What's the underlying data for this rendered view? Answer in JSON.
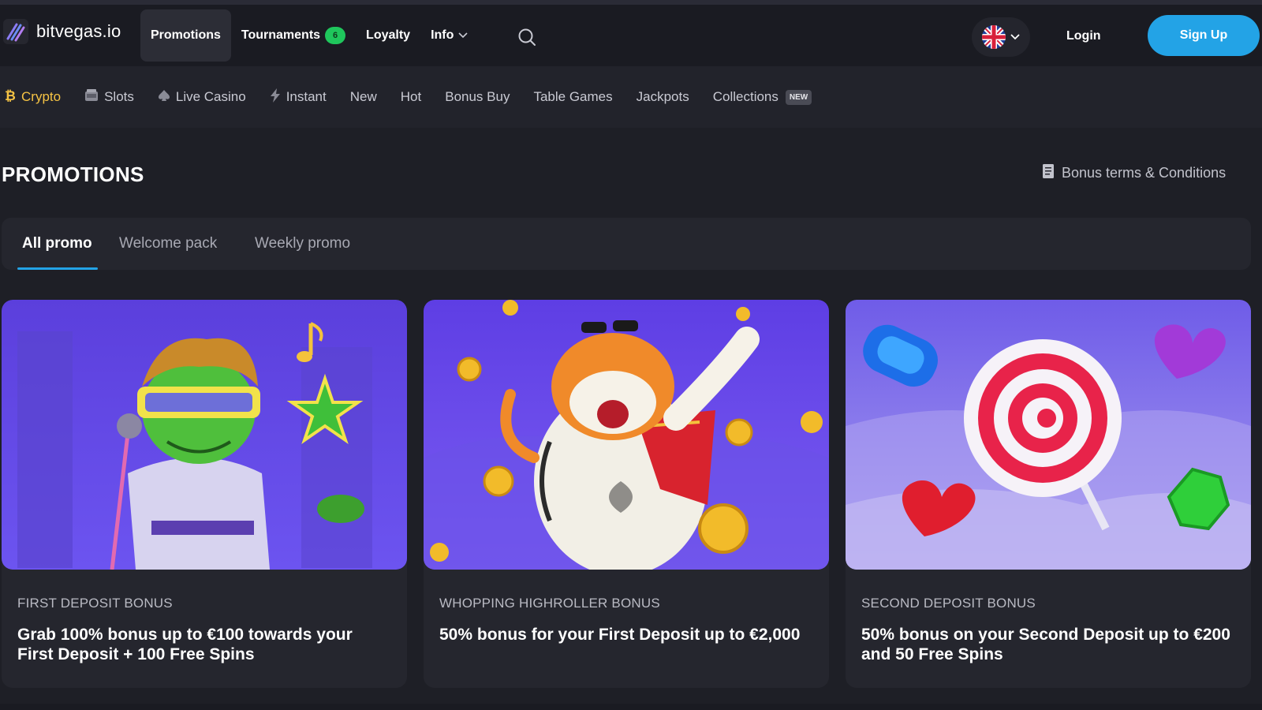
{
  "header": {
    "logo_text": "bitvegas.io",
    "nav": [
      {
        "label": "Promotions",
        "active": true
      },
      {
        "label": "Tournaments",
        "badge": "6"
      },
      {
        "label": "Loyalty"
      },
      {
        "label": "Info",
        "dropdown": true
      }
    ],
    "login_label": "Login",
    "signup_label": "Sign Up",
    "language_icon": "uk-flag-icon"
  },
  "categories": [
    {
      "label": "Crypto",
      "icon": "bitcoin-icon",
      "active": true
    },
    {
      "label": "Slots",
      "icon": "slot-machine-icon"
    },
    {
      "label": "Live Casino",
      "icon": "spade-icon"
    },
    {
      "label": "Instant",
      "icon": "lightning-icon"
    },
    {
      "label": "New"
    },
    {
      "label": "Hot"
    },
    {
      "label": "Bonus Buy"
    },
    {
      "label": "Table Games"
    },
    {
      "label": "Jackpots"
    },
    {
      "label": "Collections",
      "badge": "NEW"
    }
  ],
  "page": {
    "title": "PROMOTIONS",
    "terms_label": "Bonus terms & Conditions"
  },
  "tabs": [
    {
      "label": "All promo",
      "active": true
    },
    {
      "label": "Welcome pack"
    },
    {
      "label": "Weekly promo"
    }
  ],
  "promos": [
    {
      "category": "FIRST DEPOSIT BONUS",
      "text": "Grab 100% bonus up to €100 towards your First Deposit + 100 Free Spins",
      "art": "frog-elvis-art"
    },
    {
      "category": "WHOPPING HIGHROLLER BONUS",
      "text": "50% bonus for your First Deposit up to €2,000",
      "art": "tiger-coins-art"
    },
    {
      "category": "SECOND DEPOSIT BONUS",
      "text": "50% bonus on your Second Deposit up to €200 and 50 Free Spins",
      "art": "lollipop-candy-art"
    }
  ],
  "colors": {
    "accent": "#23a3e6",
    "crypto_active": "#f6c344",
    "badge_green": "#1fc65c",
    "card_purple": "#6a4fe6"
  }
}
